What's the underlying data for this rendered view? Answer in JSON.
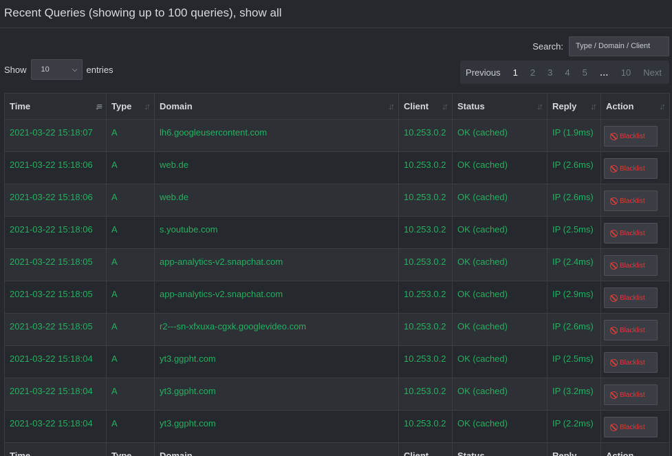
{
  "header": {
    "title": "Recent Queries (showing up to 100 queries),",
    "show_all": "show all"
  },
  "search": {
    "label": "Search:",
    "placeholder": "Type / Domain / Client"
  },
  "length": {
    "show_label": "Show",
    "value": "10",
    "entries_label": "entries"
  },
  "pagination": {
    "previous": "Previous",
    "pages": [
      "1",
      "2",
      "3",
      "4",
      "5",
      "…",
      "10"
    ],
    "active": "1",
    "next": "Next"
  },
  "table": {
    "columns": [
      "Time",
      "Type",
      "Domain",
      "Client",
      "Status",
      "Reply",
      "Action"
    ],
    "rows": [
      {
        "time": "2021-03-22 15:18:07",
        "type": "A",
        "domain": "lh6.googleusercontent.com",
        "client": "10.253.0.2",
        "status": "OK (cached)",
        "reply": "IP (1.9ms)",
        "action": "Blacklist"
      },
      {
        "time": "2021-03-22 15:18:06",
        "type": "A",
        "domain": "web.de",
        "client": "10.253.0.2",
        "status": "OK (cached)",
        "reply": "IP (2.6ms)",
        "action": "Blacklist"
      },
      {
        "time": "2021-03-22 15:18:06",
        "type": "A",
        "domain": "web.de",
        "client": "10.253.0.2",
        "status": "OK (cached)",
        "reply": "IP (2.6ms)",
        "action": "Blacklist"
      },
      {
        "time": "2021-03-22 15:18:06",
        "type": "A",
        "domain": "s.youtube.com",
        "client": "10.253.0.2",
        "status": "OK (cached)",
        "reply": "IP (2.5ms)",
        "action": "Blacklist"
      },
      {
        "time": "2021-03-22 15:18:05",
        "type": "A",
        "domain": "app-analytics-v2.snapchat.com",
        "client": "10.253.0.2",
        "status": "OK (cached)",
        "reply": "IP (2.4ms)",
        "action": "Blacklist"
      },
      {
        "time": "2021-03-22 15:18:05",
        "type": "A",
        "domain": "app-analytics-v2.snapchat.com",
        "client": "10.253.0.2",
        "status": "OK (cached)",
        "reply": "IP (2.9ms)",
        "action": "Blacklist"
      },
      {
        "time": "2021-03-22 15:18:05",
        "type": "A",
        "domain": "r2---sn-xfxuxa-cgxk.googlevideo.com",
        "client": "10.253.0.2",
        "status": "OK (cached)",
        "reply": "IP (2.6ms)",
        "action": "Blacklist"
      },
      {
        "time": "2021-03-22 15:18:04",
        "type": "A",
        "domain": "yt3.ggpht.com",
        "client": "10.253.0.2",
        "status": "OK (cached)",
        "reply": "IP (2.5ms)",
        "action": "Blacklist"
      },
      {
        "time": "2021-03-22 15:18:04",
        "type": "A",
        "domain": "yt3.ggpht.com",
        "client": "10.253.0.2",
        "status": "OK (cached)",
        "reply": "IP (3.2ms)",
        "action": "Blacklist"
      },
      {
        "time": "2021-03-22 15:18:04",
        "type": "A",
        "domain": "yt3.ggpht.com",
        "client": "10.253.0.2",
        "status": "OK (cached)",
        "reply": "IP (2.2ms)",
        "action": "Blacklist"
      }
    ]
  },
  "colors": {
    "background": "#25282d",
    "row_alt": "#2d3136",
    "text_green": "#27ae60",
    "blacklist_red": "#d93a3a"
  },
  "icons": {
    "sort": "sort-icon",
    "sort_active": "sort-desc-icon",
    "blacklist": "ban-icon",
    "select": "chevron-down-icon"
  }
}
